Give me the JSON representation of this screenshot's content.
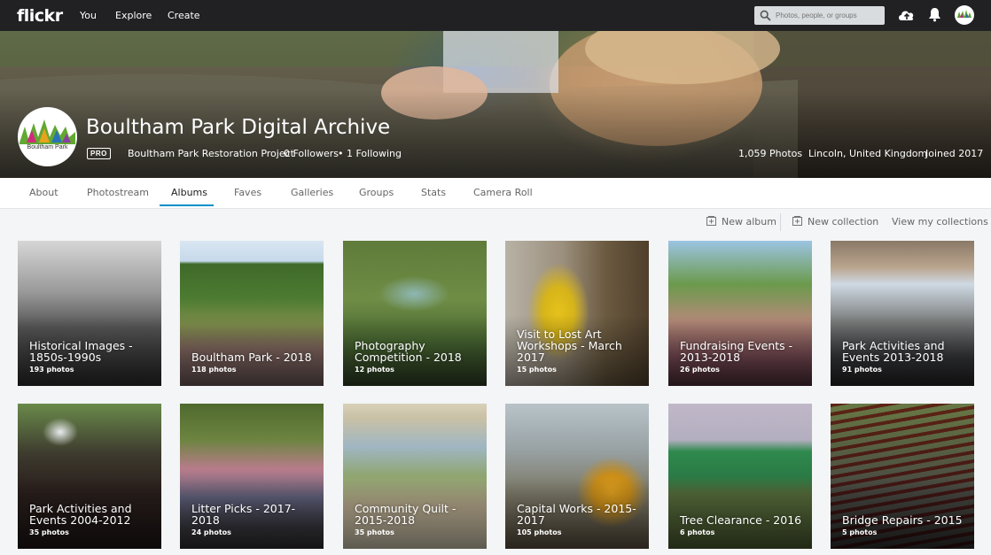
{
  "topbar": {
    "logo": "flickr",
    "nav": [
      "You",
      "Explore",
      "Create"
    ],
    "search_placeholder": "Photos, people, or groups",
    "icons": [
      "upload-cloud-icon",
      "notifications-bell-icon",
      "user-avatar"
    ]
  },
  "profile": {
    "name": "Boultham Park Digital Archive",
    "avatar_text": "Boultham Park",
    "badge": "PRO",
    "real_name": "Boultham Park Restoration Project",
    "followers": "0 Followers",
    "bullet": "•",
    "following": "1 Following",
    "photos": "1,059 Photos",
    "location": "Lincoln, United Kingdom",
    "joined": "Joined 2017"
  },
  "tabs": [
    "About",
    "Photostream",
    "Albums",
    "Faves",
    "Galleries",
    "Groups",
    "Stats",
    "Camera Roll"
  ],
  "active_tab": "Albums",
  "actions": {
    "new_album": "New album",
    "new_collection": "New collection",
    "view_collections": "View my collections"
  },
  "albums": [
    {
      "title": "Historical Images - 1850s-1990s",
      "count": "193 photos"
    },
    {
      "title": "Boultham Park - 2018",
      "count": "118 photos"
    },
    {
      "title": "Photography Competition - 2018",
      "count": "12 photos"
    },
    {
      "title": "Visit to Lost Art Workshops - March 2017",
      "count": "15 photos"
    },
    {
      "title": "Fundraising Events - 2013-2018",
      "count": "26 photos"
    },
    {
      "title": "Park Activities and Events 2013-2018",
      "count": "91 photos"
    },
    {
      "title": "Park Activities and Events 2004-2012",
      "count": "35 photos"
    },
    {
      "title": "Litter Picks - 2017-2018",
      "count": "24 photos"
    },
    {
      "title": "Community Quilt - 2015-2018",
      "count": "35 photos"
    },
    {
      "title": "Capital Works - 2015-2017",
      "count": "105 photos"
    },
    {
      "title": "Tree Clearance - 2016",
      "count": "6 photos"
    },
    {
      "title": "Bridge Repairs - 2015",
      "count": "5 photos"
    }
  ],
  "colors": {
    "topbar": "#212124",
    "accent": "#008ecc",
    "page_bg": "#f3f5f6"
  }
}
